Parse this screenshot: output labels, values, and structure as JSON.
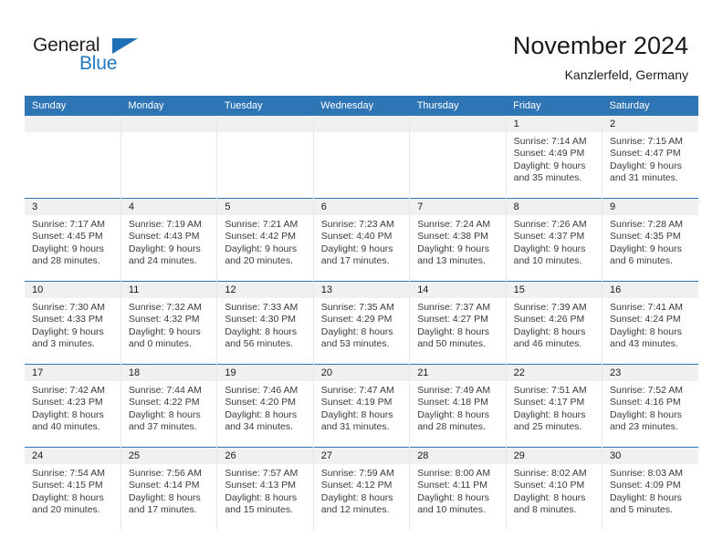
{
  "brand": {
    "name_part1": "General",
    "name_part2": "Blue"
  },
  "header": {
    "title": "November 2024",
    "location": "Kanzlerfeld, Germany"
  },
  "weekday_headers": [
    "Sunday",
    "Monday",
    "Tuesday",
    "Wednesday",
    "Thursday",
    "Friday",
    "Saturday"
  ],
  "colors": {
    "header_blue": "#2e75b6",
    "daynum_band": "#f0f0f0",
    "logo_blue": "#1f7ac4"
  },
  "weeks": [
    [
      {
        "empty": true,
        "day": ""
      },
      {
        "empty": true,
        "day": ""
      },
      {
        "empty": true,
        "day": ""
      },
      {
        "empty": true,
        "day": ""
      },
      {
        "empty": true,
        "day": ""
      },
      {
        "empty": false,
        "day": "1",
        "sunrise": "Sunrise: 7:14 AM",
        "sunset": "Sunset: 4:49 PM",
        "daylight_line1": "Daylight: 9 hours",
        "daylight_line2": "and 35 minutes."
      },
      {
        "empty": false,
        "day": "2",
        "sunrise": "Sunrise: 7:15 AM",
        "sunset": "Sunset: 4:47 PM",
        "daylight_line1": "Daylight: 9 hours",
        "daylight_line2": "and 31 minutes."
      }
    ],
    [
      {
        "empty": false,
        "day": "3",
        "sunrise": "Sunrise: 7:17 AM",
        "sunset": "Sunset: 4:45 PM",
        "daylight_line1": "Daylight: 9 hours",
        "daylight_line2": "and 28 minutes."
      },
      {
        "empty": false,
        "day": "4",
        "sunrise": "Sunrise: 7:19 AM",
        "sunset": "Sunset: 4:43 PM",
        "daylight_line1": "Daylight: 9 hours",
        "daylight_line2": "and 24 minutes."
      },
      {
        "empty": false,
        "day": "5",
        "sunrise": "Sunrise: 7:21 AM",
        "sunset": "Sunset: 4:42 PM",
        "daylight_line1": "Daylight: 9 hours",
        "daylight_line2": "and 20 minutes."
      },
      {
        "empty": false,
        "day": "6",
        "sunrise": "Sunrise: 7:23 AM",
        "sunset": "Sunset: 4:40 PM",
        "daylight_line1": "Daylight: 9 hours",
        "daylight_line2": "and 17 minutes."
      },
      {
        "empty": false,
        "day": "7",
        "sunrise": "Sunrise: 7:24 AM",
        "sunset": "Sunset: 4:38 PM",
        "daylight_line1": "Daylight: 9 hours",
        "daylight_line2": "and 13 minutes."
      },
      {
        "empty": false,
        "day": "8",
        "sunrise": "Sunrise: 7:26 AM",
        "sunset": "Sunset: 4:37 PM",
        "daylight_line1": "Daylight: 9 hours",
        "daylight_line2": "and 10 minutes."
      },
      {
        "empty": false,
        "day": "9",
        "sunrise": "Sunrise: 7:28 AM",
        "sunset": "Sunset: 4:35 PM",
        "daylight_line1": "Daylight: 9 hours",
        "daylight_line2": "and 6 minutes."
      }
    ],
    [
      {
        "empty": false,
        "day": "10",
        "sunrise": "Sunrise: 7:30 AM",
        "sunset": "Sunset: 4:33 PM",
        "daylight_line1": "Daylight: 9 hours",
        "daylight_line2": "and 3 minutes."
      },
      {
        "empty": false,
        "day": "11",
        "sunrise": "Sunrise: 7:32 AM",
        "sunset": "Sunset: 4:32 PM",
        "daylight_line1": "Daylight: 9 hours",
        "daylight_line2": "and 0 minutes."
      },
      {
        "empty": false,
        "day": "12",
        "sunrise": "Sunrise: 7:33 AM",
        "sunset": "Sunset: 4:30 PM",
        "daylight_line1": "Daylight: 8 hours",
        "daylight_line2": "and 56 minutes."
      },
      {
        "empty": false,
        "day": "13",
        "sunrise": "Sunrise: 7:35 AM",
        "sunset": "Sunset: 4:29 PM",
        "daylight_line1": "Daylight: 8 hours",
        "daylight_line2": "and 53 minutes."
      },
      {
        "empty": false,
        "day": "14",
        "sunrise": "Sunrise: 7:37 AM",
        "sunset": "Sunset: 4:27 PM",
        "daylight_line1": "Daylight: 8 hours",
        "daylight_line2": "and 50 minutes."
      },
      {
        "empty": false,
        "day": "15",
        "sunrise": "Sunrise: 7:39 AM",
        "sunset": "Sunset: 4:26 PM",
        "daylight_line1": "Daylight: 8 hours",
        "daylight_line2": "and 46 minutes."
      },
      {
        "empty": false,
        "day": "16",
        "sunrise": "Sunrise: 7:41 AM",
        "sunset": "Sunset: 4:24 PM",
        "daylight_line1": "Daylight: 8 hours",
        "daylight_line2": "and 43 minutes."
      }
    ],
    [
      {
        "empty": false,
        "day": "17",
        "sunrise": "Sunrise: 7:42 AM",
        "sunset": "Sunset: 4:23 PM",
        "daylight_line1": "Daylight: 8 hours",
        "daylight_line2": "and 40 minutes."
      },
      {
        "empty": false,
        "day": "18",
        "sunrise": "Sunrise: 7:44 AM",
        "sunset": "Sunset: 4:22 PM",
        "daylight_line1": "Daylight: 8 hours",
        "daylight_line2": "and 37 minutes."
      },
      {
        "empty": false,
        "day": "19",
        "sunrise": "Sunrise: 7:46 AM",
        "sunset": "Sunset: 4:20 PM",
        "daylight_line1": "Daylight: 8 hours",
        "daylight_line2": "and 34 minutes."
      },
      {
        "empty": false,
        "day": "20",
        "sunrise": "Sunrise: 7:47 AM",
        "sunset": "Sunset: 4:19 PM",
        "daylight_line1": "Daylight: 8 hours",
        "daylight_line2": "and 31 minutes."
      },
      {
        "empty": false,
        "day": "21",
        "sunrise": "Sunrise: 7:49 AM",
        "sunset": "Sunset: 4:18 PM",
        "daylight_line1": "Daylight: 8 hours",
        "daylight_line2": "and 28 minutes."
      },
      {
        "empty": false,
        "day": "22",
        "sunrise": "Sunrise: 7:51 AM",
        "sunset": "Sunset: 4:17 PM",
        "daylight_line1": "Daylight: 8 hours",
        "daylight_line2": "and 25 minutes."
      },
      {
        "empty": false,
        "day": "23",
        "sunrise": "Sunrise: 7:52 AM",
        "sunset": "Sunset: 4:16 PM",
        "daylight_line1": "Daylight: 8 hours",
        "daylight_line2": "and 23 minutes."
      }
    ],
    [
      {
        "empty": false,
        "day": "24",
        "sunrise": "Sunrise: 7:54 AM",
        "sunset": "Sunset: 4:15 PM",
        "daylight_line1": "Daylight: 8 hours",
        "daylight_line2": "and 20 minutes."
      },
      {
        "empty": false,
        "day": "25",
        "sunrise": "Sunrise: 7:56 AM",
        "sunset": "Sunset: 4:14 PM",
        "daylight_line1": "Daylight: 8 hours",
        "daylight_line2": "and 17 minutes."
      },
      {
        "empty": false,
        "day": "26",
        "sunrise": "Sunrise: 7:57 AM",
        "sunset": "Sunset: 4:13 PM",
        "daylight_line1": "Daylight: 8 hours",
        "daylight_line2": "and 15 minutes."
      },
      {
        "empty": false,
        "day": "27",
        "sunrise": "Sunrise: 7:59 AM",
        "sunset": "Sunset: 4:12 PM",
        "daylight_line1": "Daylight: 8 hours",
        "daylight_line2": "and 12 minutes."
      },
      {
        "empty": false,
        "day": "28",
        "sunrise": "Sunrise: 8:00 AM",
        "sunset": "Sunset: 4:11 PM",
        "daylight_line1": "Daylight: 8 hours",
        "daylight_line2": "and 10 minutes."
      },
      {
        "empty": false,
        "day": "29",
        "sunrise": "Sunrise: 8:02 AM",
        "sunset": "Sunset: 4:10 PM",
        "daylight_line1": "Daylight: 8 hours",
        "daylight_line2": "and 8 minutes."
      },
      {
        "empty": false,
        "day": "30",
        "sunrise": "Sunrise: 8:03 AM",
        "sunset": "Sunset: 4:09 PM",
        "daylight_line1": "Daylight: 8 hours",
        "daylight_line2": "and 5 minutes."
      }
    ]
  ]
}
